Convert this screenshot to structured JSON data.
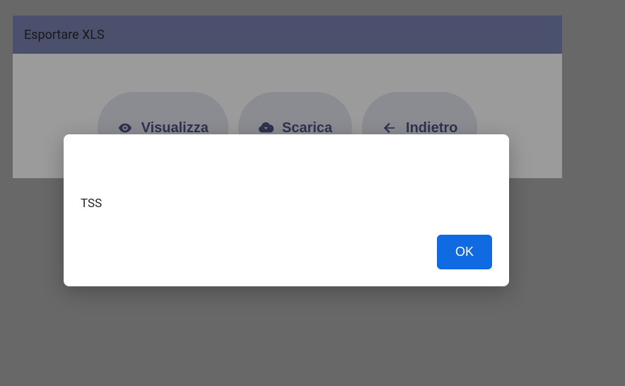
{
  "header": {
    "title": "Esportare XLS"
  },
  "actions": {
    "view": {
      "label": "Visualizza"
    },
    "download": {
      "label": "Scarica"
    },
    "back": {
      "label": "Indietro"
    }
  },
  "modal": {
    "message": "TSS",
    "ok_label": "OK"
  }
}
